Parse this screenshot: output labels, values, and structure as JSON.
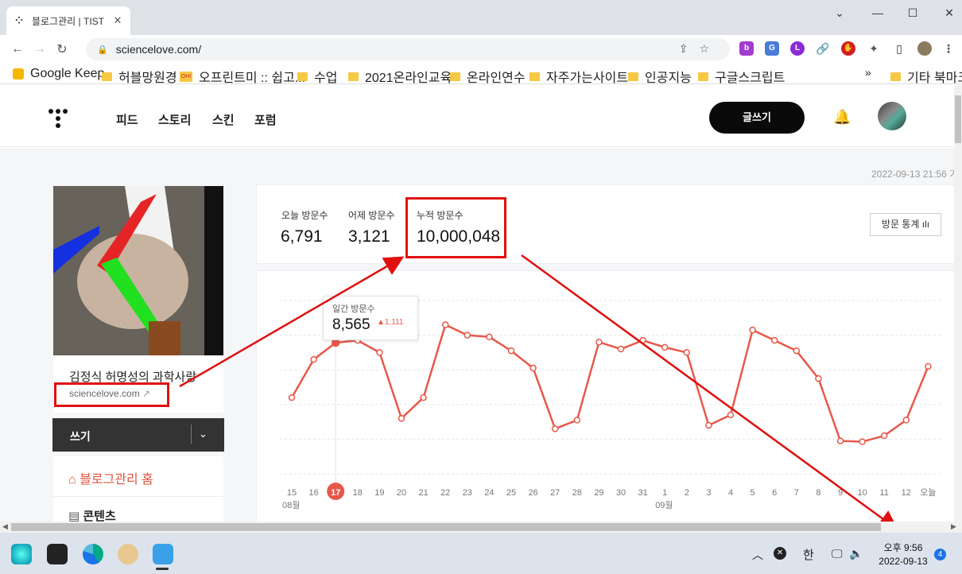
{
  "browser": {
    "tab_title": "블로그관리 | TIST",
    "url": "sciencelove.com/",
    "bookmarks": [
      "Google Keep",
      "허블망원경",
      "오프린트미 :: 쉽고...",
      "수업",
      "2021온라인교육",
      "온라인연수",
      "자주가는사이트",
      "인공지능",
      "구글스크립트"
    ],
    "bookmarks_more": "»",
    "other_bookmarks": "기타 북마크"
  },
  "tistory": {
    "nav": [
      "피드",
      "스토리",
      "스킨",
      "포럼"
    ],
    "write_button": "글쓰기",
    "datetime": "2022-09-13 21:56 기"
  },
  "blog": {
    "name": "김정식 허명성의 과학사랑",
    "url": "sciencelove.com"
  },
  "sidebar": {
    "write_label": "쓰기",
    "home_label": "블로그관리 홈",
    "contents_label": "콘텐츠"
  },
  "stats": {
    "today_label": "오늘 방문수",
    "today_value": "6,791",
    "yesterday_label": "어제 방문수",
    "yesterday_value": "3,121",
    "total_label": "누적 방문수",
    "total_value": "10,000,048",
    "button_label": "방문 통계"
  },
  "tooltip": {
    "label": "일간 방문수",
    "value": "8,565",
    "delta": "1,111"
  },
  "chart_data": {
    "type": "line",
    "categories": [
      "15",
      "16",
      "17",
      "18",
      "19",
      "20",
      "21",
      "22",
      "23",
      "24",
      "25",
      "26",
      "27",
      "28",
      "29",
      "30",
      "31",
      "1",
      "2",
      "3",
      "4",
      "5",
      "6",
      "7",
      "8",
      "9",
      "10",
      "11",
      "12",
      "오늘"
    ],
    "month_labels": [
      {
        "index": 0,
        "label": "08월"
      },
      {
        "index": 17,
        "label": "09월"
      }
    ],
    "highlight_index": 2,
    "series": [
      {
        "values": [
          5400,
          7600,
          8565,
          8700,
          8000,
          4200,
          5400,
          9600,
          9000,
          8900,
          8100,
          7100,
          3600,
          4100,
          8600,
          8200,
          8700,
          8300,
          8000,
          3800,
          4400,
          9300,
          8700,
          8100,
          6500,
          2900,
          2850,
          3200,
          4100,
          7200
        ]
      }
    ],
    "ylim": [
      1000,
      11000
    ],
    "color": "#e8584a"
  },
  "taskbar": {
    "ime": "한",
    "time": "오후 9:56",
    "date": "2022-09-13",
    "notifications": "4"
  }
}
